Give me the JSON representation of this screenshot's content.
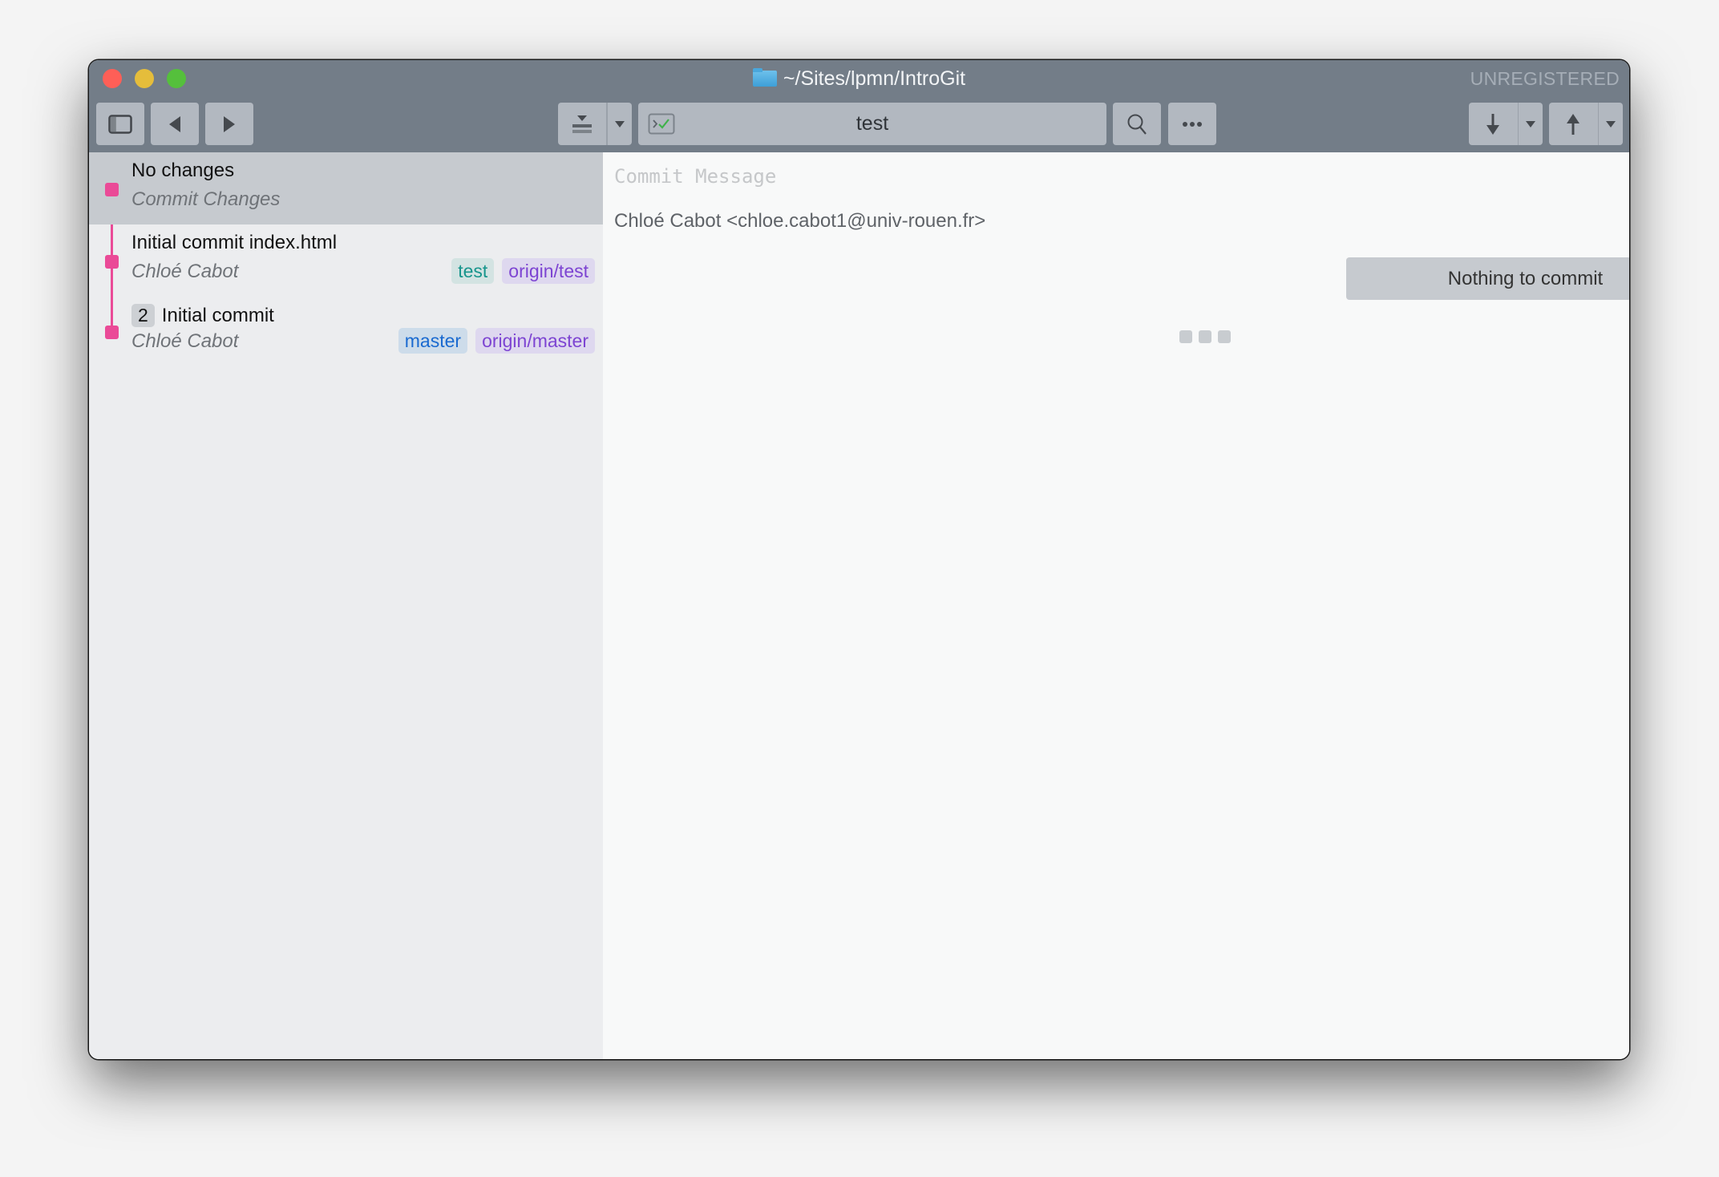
{
  "window": {
    "title": "~/Sites/lpmn/IntroGit",
    "registration_status": "UNREGISTERED"
  },
  "toolbar": {
    "sidebar_toggle_icon": "sidebar-toggle-icon",
    "back_icon": "triangle-left-icon",
    "forward_icon": "triangle-right-icon",
    "stash_icon": "stash-icon",
    "branch_field": {
      "status_icon": "terminal-check-icon",
      "value": "test"
    },
    "search_icon": "magnifier-icon",
    "more_icon": "ellipsis-icon",
    "pull_icon": "arrow-down-icon",
    "push_icon": "arrow-up-icon"
  },
  "colors": {
    "titlebar": "#737d88",
    "graph": "#ea4a97",
    "sidebar_bg": "#ecedef",
    "selected_row": "#c6cacf"
  },
  "history": [
    {
      "subject": "No changes",
      "author": "Commit Changes",
      "selected": true,
      "refs": []
    },
    {
      "subject": "Initial commit index.html",
      "author": "Chloé Cabot",
      "selected": false,
      "refs": [
        {
          "label": "test",
          "kind": "local"
        },
        {
          "label": "origin/test",
          "kind": "remote"
        }
      ]
    },
    {
      "count": "2",
      "subject": "Initial commit",
      "author": "Chloé Cabot",
      "selected": false,
      "refs": [
        {
          "label": "master",
          "kind": "local"
        },
        {
          "label": "origin/master",
          "kind": "remote"
        }
      ]
    }
  ],
  "commit_panel": {
    "message_placeholder": "Commit Message",
    "message_value": "",
    "identity": "Chloé Cabot <chloe.cabot1@univ-rouen.fr>",
    "commit_button_label": "Nothing to commit"
  }
}
